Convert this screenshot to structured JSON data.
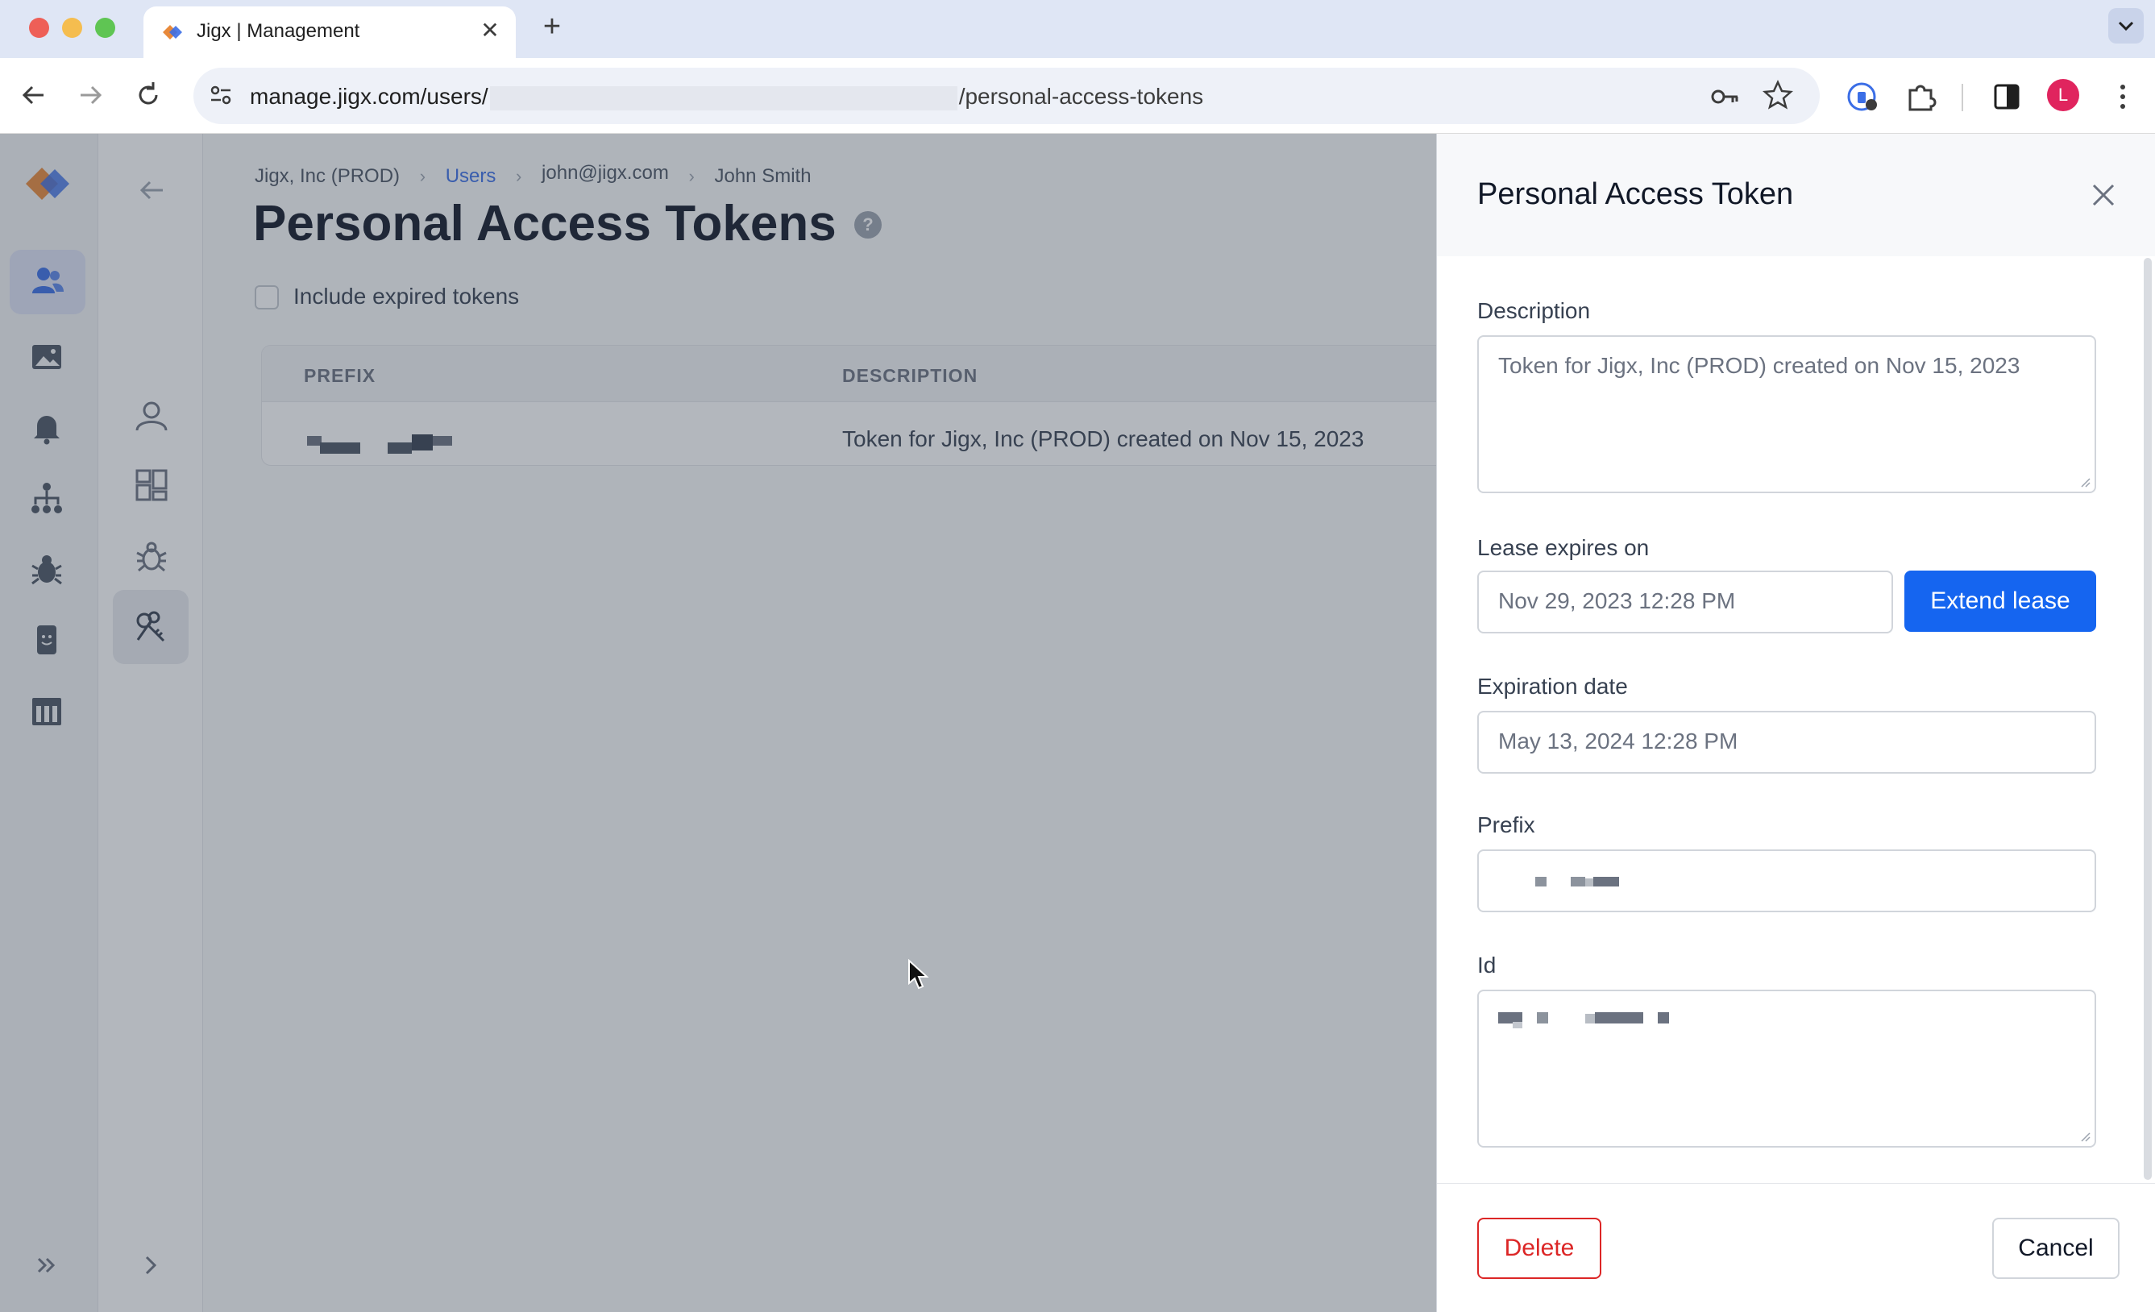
{
  "browser": {
    "tab_title": "Jigx | Management",
    "tab_close": "✕",
    "new_tab": "+",
    "url_prefix": "manage.jigx.com/users/",
    "url_path": "/personal-access-tokens",
    "profile_initial": "L"
  },
  "breadcrumbs": {
    "org": "Jigx, Inc (PROD)",
    "users": "Users",
    "email": "john@jigx.com",
    "name": "John Smith",
    "separator": "›"
  },
  "page": {
    "title": "Personal Access Tokens",
    "help": "?",
    "include_expired_label": "Include expired tokens"
  },
  "table": {
    "columns": [
      "PREFIX",
      "DESCRIPTION"
    ],
    "rows": [
      {
        "description": "Token for Jigx, Inc (PROD) created on Nov 15, 2023"
      }
    ]
  },
  "drawer": {
    "title": "Personal Access Token",
    "description_label": "Description",
    "description_value": "Token for Jigx, Inc (PROD) created on Nov 15, 2023",
    "lease_label": "Lease expires on",
    "lease_value": "Nov 29, 2023 12:28 PM",
    "extend_button": "Extend lease",
    "expiration_label": "Expiration date",
    "expiration_value": "May 13, 2024 12:28 PM",
    "prefix_label": "Prefix",
    "id_label": "Id",
    "delete_button": "Delete",
    "cancel_button": "Cancel"
  },
  "colors": {
    "primary": "#1565f0",
    "danger": "#dc2626",
    "link": "#3b6ee6",
    "brand_orange": "#e8893a",
    "brand_blue": "#3b6ee6"
  },
  "icons": {
    "rail": [
      "users-icon",
      "images-icon",
      "bell-icon",
      "hierarchy-icon",
      "bug-icon",
      "mobile-icon",
      "store-icon",
      "expand-icon"
    ],
    "subnav": [
      "back-arrow-icon",
      "user-icon",
      "dashboard-icon",
      "bug-icon",
      "keys-icon",
      "chevron-right-icon"
    ]
  }
}
